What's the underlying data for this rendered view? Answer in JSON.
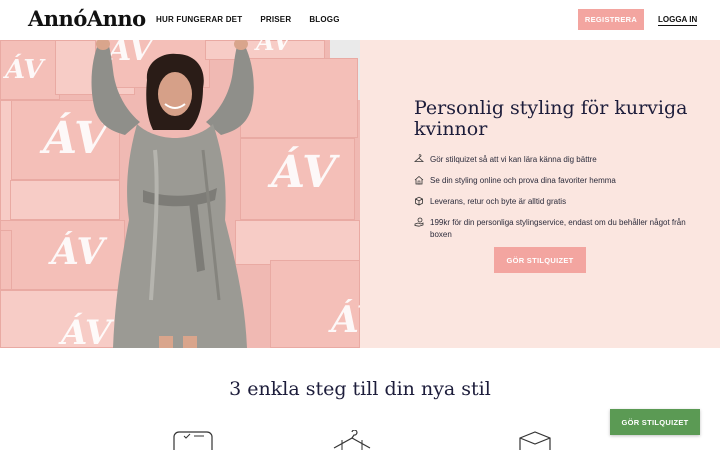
{
  "header": {
    "logo": "AnnóAnno",
    "nav": [
      "HUR FUNGERAR DET",
      "PRISER",
      "BLOGG"
    ],
    "register_label": "REGISTRERA",
    "login_label": "LOGGA IN"
  },
  "hero": {
    "title": "Personlig styling för kurviga kvinnor",
    "features": [
      {
        "icon": "hanger-icon",
        "text": "Gör stilquizet så att vi kan lära känna dig bättre"
      },
      {
        "icon": "home-icon",
        "text": "Se din styling online och prova dina favoriter hemma"
      },
      {
        "icon": "box-icon",
        "text": "Leverans, retur och byte är alltid gratis"
      },
      {
        "icon": "money-hand-icon",
        "text": "199kr för din personliga stylingservice, endast om du behåller något från boxen"
      }
    ],
    "cta_label": "GÖR STILQUIZET",
    "box_monogram": "ÁV"
  },
  "steps": {
    "title": "3 enkla steg till din nya stil",
    "icons": [
      "phone-icon",
      "hanger-icon",
      "box-icon"
    ]
  },
  "floating_cta_label": "GÖR STILQUIZET",
  "colors": {
    "accent": "#f3a5a0",
    "hero_bg": "#fbe6e0",
    "green": "#5b9a54",
    "text": "#1d1d3b"
  }
}
